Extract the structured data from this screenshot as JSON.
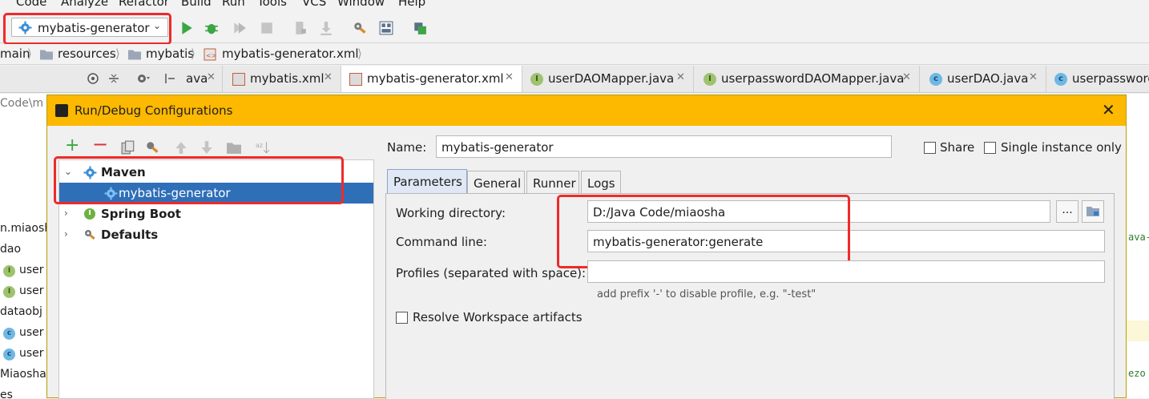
{
  "menu": [
    "Code",
    "Analyze",
    "Refactor",
    "Build",
    "Run",
    "Tools",
    "VCS",
    "Window",
    "Help"
  ],
  "toolbar": {
    "run_config": "mybatis-generator",
    "icons": [
      "run-icon",
      "debug-icon",
      "coverage-icon",
      "stop-icon",
      "build-icon",
      "download-icon",
      "settings-icon",
      "project-structure-icon",
      "sdk-icon"
    ]
  },
  "breadcrumb": [
    "main",
    "resources",
    "mybatis",
    "mybatis-generator.xml"
  ],
  "editor_tabs": [
    {
      "label": "ava",
      "icon": "java-icon"
    },
    {
      "label": "mybatis.xml",
      "icon": "xml-icon"
    },
    {
      "label": "mybatis-generator.xml",
      "icon": "xml-icon",
      "active": true
    },
    {
      "label": "userDAOMapper.java",
      "icon": "interface-icon"
    },
    {
      "label": "userpasswordDAOMapper.java",
      "icon": "interface-icon"
    },
    {
      "label": "userDAO.java",
      "icon": "class-icon"
    },
    {
      "label": "userpassword",
      "icon": "class-icon"
    }
  ],
  "project_panel": {
    "path": "Code\\m",
    "items": [
      "n.miaosh",
      "dao",
      "user",
      "user",
      "dataobj",
      "user",
      "user",
      "Miaosha",
      "es"
    ]
  },
  "dialog": {
    "title": "Run/Debug Configurations",
    "tree": {
      "groups": [
        {
          "label": "Maven",
          "expanded": true,
          "children": [
            "mybatis-generator"
          ]
        },
        {
          "label": "Spring Boot",
          "expanded": false
        },
        {
          "label": "Defaults",
          "expanded": false
        }
      ]
    },
    "name_label": "Name:",
    "name_value": "mybatis-generator",
    "share_label": "Share",
    "single_instance_label": "Single instance only",
    "tabs": [
      "Parameters",
      "General",
      "Runner",
      "Logs"
    ],
    "working_dir_label": "Working directory:",
    "working_dir_value": "D:/Java Code/miaosha",
    "browse_label": "...",
    "command_line_label": "Command line:",
    "command_line_value": "mybatis-generator:generate",
    "profiles_label": "Profiles (separated with space):",
    "profiles_hint": "add prefix '-' to disable profile, e.g. \"-test\"",
    "resolve_workspace_label": "Resolve Workspace artifacts"
  },
  "editor_right": [
    "ava-",
    "ezo"
  ],
  "colors": {
    "dialog_title_bg": "#fdb800",
    "selection": "#2f6fb8",
    "highlight_box": "#ee2a2a"
  }
}
